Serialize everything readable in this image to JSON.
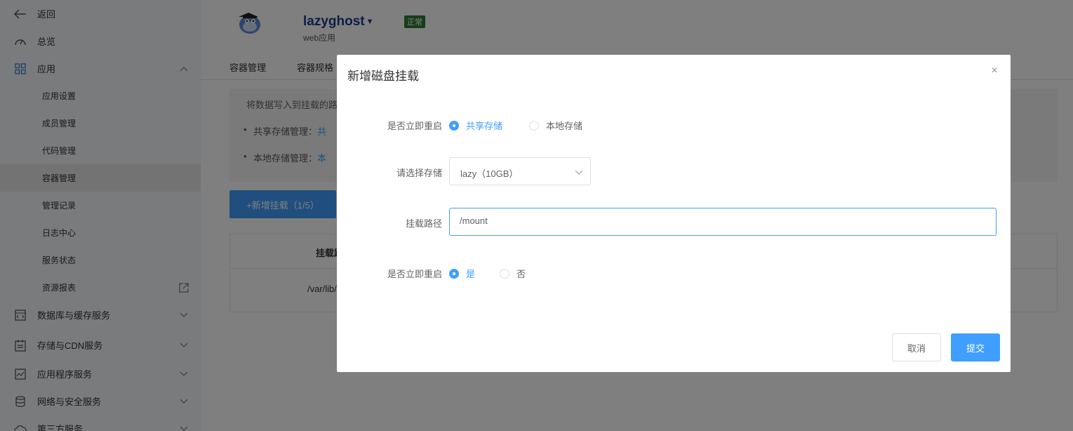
{
  "sidebar": {
    "back": "返回",
    "overview": "总览",
    "app": "应用",
    "sub_items": [
      "应用设置",
      "成员管理",
      "代码管理",
      "容器管理",
      "管理记录",
      "日志中心",
      "服务状态",
      "资源报表"
    ],
    "groups": [
      "数据库与缓存服务",
      "存储与CDN服务",
      "应用程序服务",
      "网络与安全服务",
      "第三方服务"
    ]
  },
  "header": {
    "app_name": "lazyghost",
    "app_type": "web应用",
    "status": "正常"
  },
  "tabs": [
    "容器管理",
    "容器规格"
  ],
  "notice": {
    "intro": "将数据写入到挂载的路",
    "items": [
      {
        "label": "共享存储管理：",
        "link": "共"
      },
      {
        "label": "本地存储管理：",
        "link": "本"
      }
    ]
  },
  "add_button": "+新增挂载（1/5）",
  "table": {
    "header": "挂载路",
    "row": "/var/lib/"
  },
  "modal": {
    "title": "新增磁盘挂载",
    "close": "×",
    "fields": {
      "storage_type_label": "是否立即重启",
      "storage_options": [
        "共享存储",
        "本地存储"
      ],
      "select_label": "请选择存储",
      "select_value": "lazy（10GB）",
      "path_label": "挂载路径",
      "path_value": "/mount",
      "restart_label": "是否立即重启",
      "restart_options": [
        "是",
        "否"
      ]
    },
    "cancel": "取消",
    "submit": "提交"
  },
  "colors": {
    "primary": "#409eff",
    "status_green": "#2e7d32",
    "brand_text": "#1e3a8a"
  }
}
